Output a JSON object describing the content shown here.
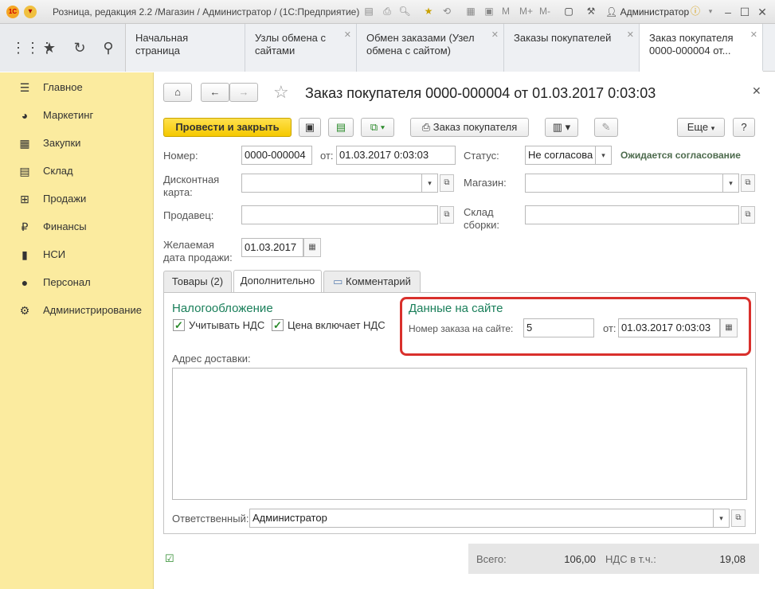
{
  "window": {
    "title": "Розница, редакция 2.2 /Магазин / Администратор /  (1С:Предприятие)",
    "user": "Администратор",
    "toolbar_letters": [
      "M",
      "M+",
      "M-"
    ]
  },
  "nav_tabs": [
    {
      "label": "Начальная страница",
      "closable": false
    },
    {
      "label": "Узлы обмена с сайтами",
      "closable": true
    },
    {
      "label": "Обмен заказами (Узел обмена с сайтом)",
      "closable": true
    },
    {
      "label": "Заказы покупателей",
      "closable": true
    },
    {
      "label": "Заказ покупателя 0000-000004 от...",
      "closable": true
    }
  ],
  "sidebar": {
    "items": [
      {
        "label": "Главное",
        "icon": "menu-icon"
      },
      {
        "label": "Маркетинг",
        "icon": "pie-chart-icon"
      },
      {
        "label": "Закупки",
        "icon": "truck-icon"
      },
      {
        "label": "Склад",
        "icon": "warehouse-icon"
      },
      {
        "label": "Продажи",
        "icon": "basket-icon"
      },
      {
        "label": "Финансы",
        "icon": "ruble-icon"
      },
      {
        "label": "НСИ",
        "icon": "book-icon"
      },
      {
        "label": "Персонал",
        "icon": "person-icon"
      },
      {
        "label": "Администрирование",
        "icon": "gear-icon"
      }
    ]
  },
  "form": {
    "title": "Заказ покупателя 0000-000004 от 01.03.2017 0:03:03",
    "buttons": {
      "post_close": "Провести и закрыть",
      "print": "Заказ покупателя",
      "more": "Еще",
      "help": "?"
    },
    "fields": {
      "number_label": "Номер:",
      "number_value": "0000-000004",
      "from_label": "от:",
      "date_value": "01.03.2017  0:03:03",
      "status_label": "Статус:",
      "status_value": "Не согласова",
      "status_note": "Ожидается согласование",
      "discount_label": "Дисконтная карта:",
      "discount_value": "",
      "store_label": "Магазин:",
      "store_value": "",
      "seller_label": "Продавец:",
      "seller_value": "",
      "assembly_label": "Склад сборки:",
      "assembly_value": "",
      "desired_label": "Желаемая дата продажи:",
      "desired_value": "01.03.2017"
    },
    "tabs": [
      "Товары (2)",
      "Дополнительно",
      "Комментарий"
    ],
    "tax": {
      "heading": "Налогообложение",
      "vat_label": "Учитывать НДС",
      "vat_checked": true,
      "price_vat_label": "Цена включает НДС",
      "price_vat_checked": true
    },
    "site": {
      "heading": "Данные на сайте",
      "order_label": "Номер заказа на сайте:",
      "order_value": "5",
      "from_label": "от:",
      "date_value": "01.03.2017  0:03:03",
      "highlight_color": "#d9302c"
    },
    "delivery_label": "Адрес доставки:",
    "delivery_value": "",
    "responsible_label": "Ответственный:",
    "responsible_value": "Администратор",
    "totals": {
      "total_label": "Всего:",
      "total_value": "106,00",
      "vat_label": "НДС в т.ч.:",
      "vat_value": "19,08"
    }
  }
}
